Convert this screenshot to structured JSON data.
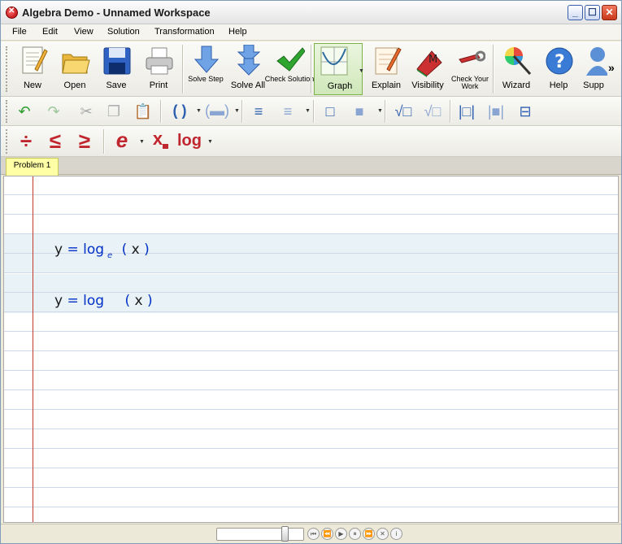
{
  "window": {
    "title": "Algebra Demo - Unnamed Workspace"
  },
  "menu": [
    "File",
    "Edit",
    "View",
    "Solution",
    "Transformation",
    "Help"
  ],
  "toolbar1": {
    "new": "New",
    "open": "Open",
    "save": "Save",
    "print": "Print",
    "solve_step": "Solve Step",
    "solve_all": "Solve All",
    "check_solution": "Check Solution",
    "graph": "Graph",
    "explain": "Explain",
    "visibility": "Visibility",
    "check_your_work": "Check Your Work",
    "wizard": "Wizard",
    "help": "Help",
    "support": "Supp",
    "overflow": "»"
  },
  "toolbar3": {
    "exp": "e",
    "subscript": "x",
    "log": "log"
  },
  "tabs": [
    {
      "label": "Problem 1"
    }
  ],
  "workspace": {
    "equations": [
      {
        "lhs": "y",
        "op": "=",
        "fn": "log",
        "base": "e",
        "open": "(",
        "arg": "x",
        "close": ")"
      },
      {
        "lhs": "y",
        "op": "=",
        "fn": "log",
        "base": "",
        "open": "(",
        "arg": "x",
        "close": ")"
      }
    ]
  },
  "colors": {
    "accent": "#0030c8",
    "margin": "#c0392b",
    "tab": "#ffffa6"
  }
}
